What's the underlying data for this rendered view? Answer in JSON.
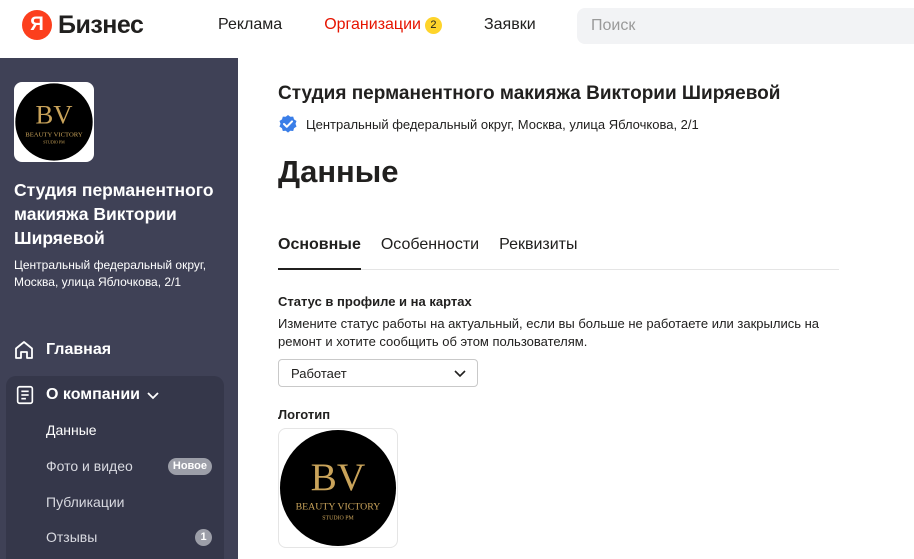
{
  "header": {
    "ya_letter": "Я",
    "brand": "Бизнес",
    "nav": [
      {
        "label": "Реклама"
      },
      {
        "label": "Организации",
        "badge": "2"
      },
      {
        "label": "Заявки"
      }
    ],
    "search_placeholder": "Поиск"
  },
  "sidebar": {
    "org_name": "Студия перманентного макияжа Виктории Ширяевой",
    "address": "Центральный федеральный округ, Москва, улица Яблочкова, 2/1",
    "home_label": "Главная",
    "company_label": "О компании",
    "sub_items": [
      {
        "label": "Данные"
      },
      {
        "label": "Фото и видео",
        "badge": "Новое"
      },
      {
        "label": "Публикации"
      },
      {
        "label": "Отзывы",
        "badge": "1"
      }
    ]
  },
  "main": {
    "org_title": "Студия перманентного макияжа Виктории Ширяевой",
    "org_address": "Центральный федеральный округ, Москва, улица Яблочкова, 2/1",
    "page_title": "Данные",
    "tabs": [
      {
        "label": "Основные"
      },
      {
        "label": "Особенности"
      },
      {
        "label": "Реквизиты"
      }
    ],
    "status_label": "Статус в профиле и на картах",
    "status_desc": "Измените статус работы на актуальный, если вы больше не работаете или закрылись на ремонт и хотите сообщить об этом пользователям.",
    "status_value": "Работает",
    "logo_label": "Логотип"
  },
  "logo_image": {
    "monogram": "BV",
    "line1": "BEAUTY VICTORY",
    "line2": "STUDIO PM"
  },
  "colors": {
    "accent_red": "#e61400",
    "badge_yellow": "#fed42b",
    "sidebar_bg": "#3f4156",
    "verified_blue": "#3a7ee8",
    "logo_gold": "#c9a35a"
  }
}
